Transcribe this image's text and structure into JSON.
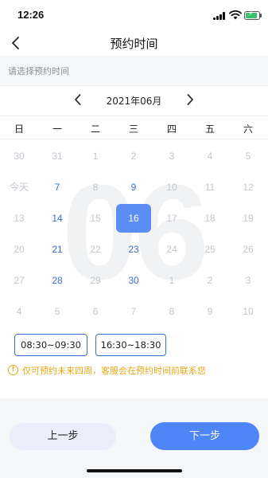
{
  "status_bar": {
    "time": "12:26"
  },
  "nav": {
    "title": "预约时间"
  },
  "hint": {
    "text": "请选择预约时间"
  },
  "calendar": {
    "month_label": "2021年06月",
    "watermark": "06",
    "weekdays": [
      "日",
      "一",
      "二",
      "三",
      "四",
      "五",
      "六"
    ],
    "weeks": [
      [
        {
          "label": "30",
          "state": "disabled"
        },
        {
          "label": "31",
          "state": "disabled"
        },
        {
          "label": "1",
          "state": "disabled"
        },
        {
          "label": "2",
          "state": "disabled"
        },
        {
          "label": "3",
          "state": "disabled"
        },
        {
          "label": "4",
          "state": "disabled"
        },
        {
          "label": "5",
          "state": "disabled"
        }
      ],
      [
        {
          "label": "今天",
          "state": "disabled"
        },
        {
          "label": "7",
          "state": "available"
        },
        {
          "label": "8",
          "state": "disabled"
        },
        {
          "label": "9",
          "state": "available"
        },
        {
          "label": "10",
          "state": "disabled"
        },
        {
          "label": "11",
          "state": "disabled"
        },
        {
          "label": "12",
          "state": "disabled"
        }
      ],
      [
        {
          "label": "13",
          "state": "disabled"
        },
        {
          "label": "14",
          "state": "available"
        },
        {
          "label": "15",
          "state": "disabled"
        },
        {
          "label": "16",
          "state": "selected"
        },
        {
          "label": "17",
          "state": "disabled"
        },
        {
          "label": "18",
          "state": "disabled"
        },
        {
          "label": "19",
          "state": "disabled"
        }
      ],
      [
        {
          "label": "20",
          "state": "disabled"
        },
        {
          "label": "21",
          "state": "available"
        },
        {
          "label": "22",
          "state": "disabled"
        },
        {
          "label": "23",
          "state": "available"
        },
        {
          "label": "24",
          "state": "disabled"
        },
        {
          "label": "25",
          "state": "disabled"
        },
        {
          "label": "26",
          "state": "disabled"
        }
      ],
      [
        {
          "label": "27",
          "state": "disabled"
        },
        {
          "label": "28",
          "state": "available"
        },
        {
          "label": "29",
          "state": "disabled"
        },
        {
          "label": "30",
          "state": "available"
        },
        {
          "label": "1",
          "state": "disabled"
        },
        {
          "label": "2",
          "state": "disabled"
        },
        {
          "label": "3",
          "state": "disabled"
        }
      ],
      [
        {
          "label": "4",
          "state": "disabled"
        },
        {
          "label": "5",
          "state": "disabled"
        },
        {
          "label": "6",
          "state": "disabled"
        },
        {
          "label": "7",
          "state": "disabled"
        },
        {
          "label": "8",
          "state": "disabled"
        },
        {
          "label": "9",
          "state": "disabled"
        },
        {
          "label": "10",
          "state": "disabled"
        }
      ]
    ]
  },
  "time_slots": [
    "08:30~09:30",
    "16:30~18:30"
  ],
  "notice": {
    "icon": "info-icon",
    "text": "仅可预约未来四周，客服会在预约时间前联系您"
  },
  "buttons": {
    "prev_label": "上一步",
    "next_label": "下一步"
  },
  "colors": {
    "accent": "#4f86f7",
    "selected_bg": "#5b8df5",
    "available_text": "#3a6fce",
    "disabled_text": "#c3c6cc",
    "notice": "#e6a817"
  }
}
